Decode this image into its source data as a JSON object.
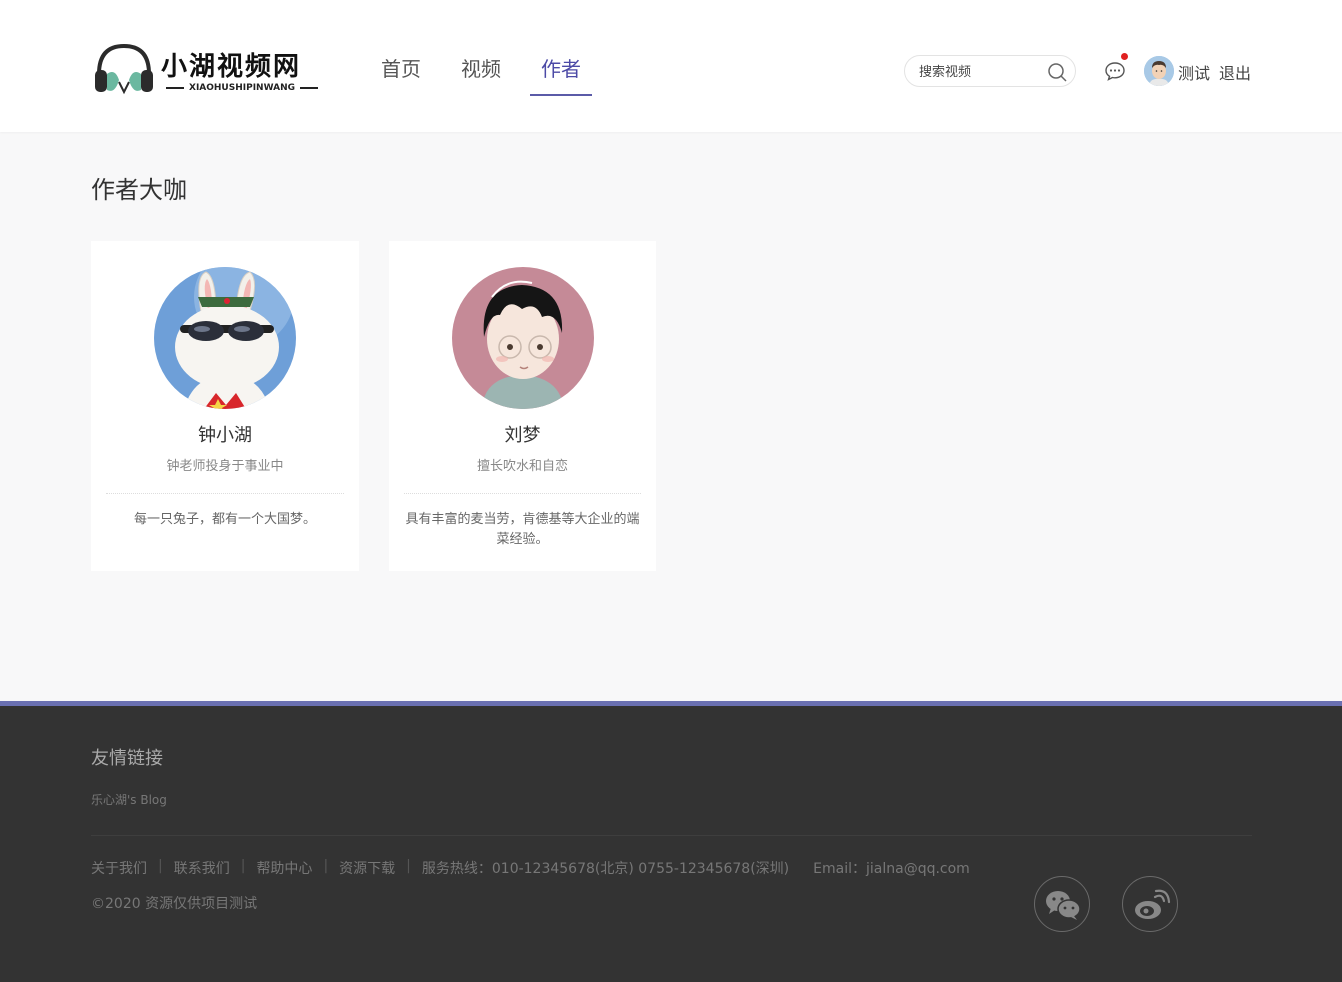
{
  "header": {
    "logo": {
      "title": "小湖视频网",
      "subtitle": "XIAOHUSHIPINWANG"
    },
    "nav": [
      {
        "label": "首页",
        "active": false
      },
      {
        "label": "视频",
        "active": false
      },
      {
        "label": "作者",
        "active": true
      }
    ],
    "search": {
      "placeholder": "搜索视频",
      "icon": "search-icon"
    },
    "message_icon": "chat-bubble-icon",
    "notification_color": "#e02020",
    "user": {
      "name": "测试",
      "logout_label": "退出"
    }
  },
  "main": {
    "title": "作者大咖",
    "authors": [
      {
        "name": "钟小湖",
        "title": "钟老师投身于事业中",
        "description": "每一只兔子，都有一个大国梦。"
      },
      {
        "name": "刘梦",
        "title": "擅长吹水和自恋",
        "description": "具有丰富的麦当劳，肯德基等大企业的端菜经验。"
      }
    ]
  },
  "footer": {
    "friend_links_title": "友情链接",
    "friend_links": [
      "乐心湖's Blog"
    ],
    "links": [
      "关于我们",
      "联系我们",
      "帮助中心",
      "资源下载"
    ],
    "hotline": "服务热线：010-12345678(北京) 0755-12345678(深圳)",
    "email": "Email：jialna@qq.com",
    "copyright": "©2020 资源仅供项目测试",
    "social": [
      "wechat-icon",
      "weibo-icon"
    ]
  },
  "colors": {
    "accent": "#5b5ba8",
    "footer_bg": "#333333",
    "footer_border": "#6a70b2",
    "page_bg": "#f8f8f9"
  }
}
